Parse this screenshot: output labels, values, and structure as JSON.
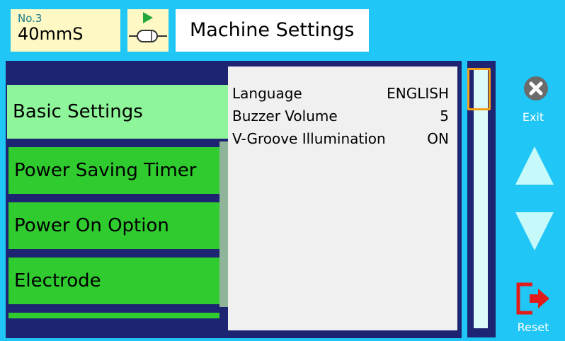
{
  "header": {
    "program_no": "No.3",
    "program_name": "40mmS",
    "mode_icon": "fiber-play-icon",
    "title": "Machine Settings"
  },
  "menu": {
    "items": [
      {
        "label": "Basic Settings",
        "selected": true
      },
      {
        "label": "Power Saving Timer",
        "selected": false
      },
      {
        "label": "Power On Option",
        "selected": false
      },
      {
        "label": "Electrode",
        "selected": false
      }
    ]
  },
  "details": [
    {
      "key": "Language",
      "value": "ENGLISH"
    },
    {
      "key": "Buzzer Volume",
      "value": "5"
    },
    {
      "key": "V-Groove Illumination",
      "value": "ON"
    }
  ],
  "side": {
    "exit_label": "Exit",
    "reset_label": "Reset"
  },
  "colors": {
    "background": "#1fc6f6",
    "panel": "#1d2471",
    "menu_item": "#2fcb2f",
    "menu_selected": "#8ef59a",
    "scroll_highlight": "#f2a01a"
  }
}
